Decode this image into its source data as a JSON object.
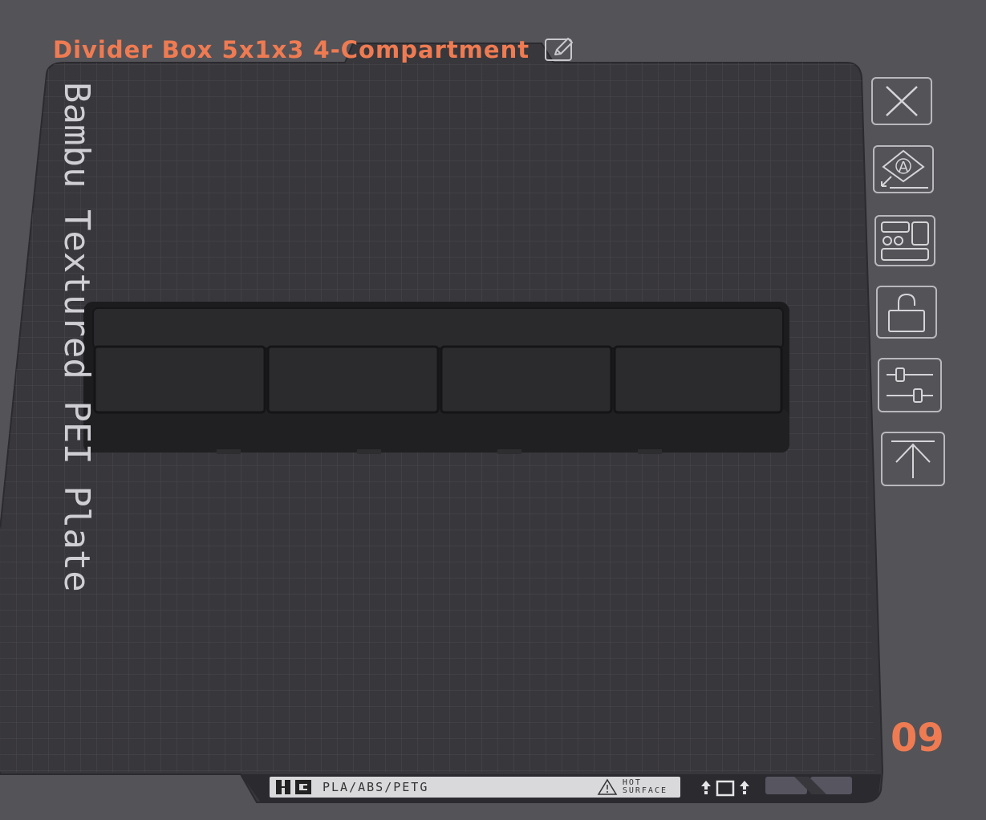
{
  "plate": {
    "title": "Divider Box 5x1x3 4-Compartment",
    "label": "Bambu Textured PEI Plate",
    "number": "09"
  },
  "sticker": {
    "material": "PLA/ABS/PETG",
    "hot_line1": "HOT",
    "hot_line2": "SURFACE"
  },
  "icons": {
    "edit": "edit-icon",
    "close": "close-icon",
    "auto_orient": "auto-orient-icon",
    "arrange": "arrange-icon",
    "lock": "lock-icon",
    "settings": "settings-sliders-icon",
    "move_top": "move-to-top-icon"
  },
  "colors": {
    "background": "#545358",
    "plate": "#37363c",
    "title": "#ef7b52",
    "model": "#1d1d1f"
  }
}
